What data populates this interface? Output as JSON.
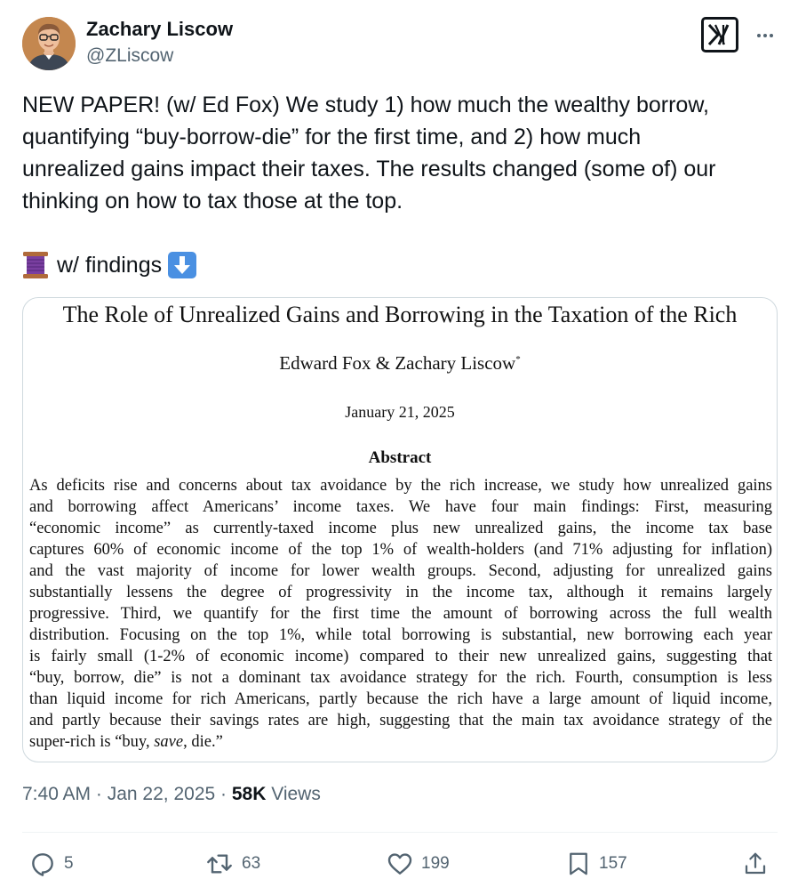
{
  "author": {
    "name": "Zachary Liscow",
    "handle": "@ZLiscow"
  },
  "tweet": {
    "lines": [
      "NEW PAPER! (w/ Ed Fox) We study 1) how much the wealthy borrow,",
      "quantifying “buy-borrow-die” for the first time, and 2) how much",
      "unrealized gains impact their taxes. The results changed (some of) our",
      "thinking on how to tax those at the top."
    ],
    "thread_text": "w/ findings"
  },
  "paper": {
    "title": "The Role of Unrealized Gains and Borrowing in the Taxation of the Rich",
    "authors": "Edward Fox & Zachary Liscow",
    "author_mark": "*",
    "date": "January 21, 2025",
    "abstract_heading": "Abstract",
    "abstract_lines": [
      "As deficits rise and concerns about tax avoidance by the rich increase, we study how unrealized gains",
      "and borrowing affect Americans’ income taxes. We have four main findings: First, measuring",
      "“economic income” as currently-taxed income plus new unrealized gains, the income tax base",
      "captures 60% of economic income of the top 1% of wealth-holders (and 71% adjusting for inflation)",
      "and the vast majority of income for lower wealth groups. Second, adjusting for unrealized gains",
      "substantially lessens the degree of progressivity in the income tax, although it remains largely",
      "progressive. Third, we quantify for the first time the amount of borrowing across the full wealth",
      "distribution. Focusing on the top 1%, while total borrowing is substantial, new borrowing each year",
      "is fairly small (1-2% of economic income) compared to their new unrealized gains, suggesting that",
      "“buy, borrow, die” is not a dominant tax avoidance strategy for the rich. Fourth, consumption is less",
      "than liquid income for rich Americans, partly because the rich have a large amount of liquid income,",
      "and partly because their savings rates are high, suggesting that the main tax avoidance strategy of the"
    ],
    "abstract_last_prefix": "super-rich is “buy, ",
    "abstract_last_italic": "save",
    "abstract_last_suffix": ", die.”"
  },
  "meta": {
    "time": "7:40 AM",
    "separator": " · ",
    "date": "Jan 22, 2025",
    "views_count": "58K",
    "views_label": " Views"
  },
  "actions": {
    "replies": "5",
    "reposts": "63",
    "likes": "199",
    "bookmarks": "157"
  },
  "colors": {
    "text": "#0f1419",
    "secondary": "#536471",
    "border": "#cfd9de"
  },
  "icons": [
    "x-logo-icon",
    "more-icon",
    "spool-of-thread-icon",
    "down-arrow-icon",
    "reply-icon",
    "repost-icon",
    "like-icon",
    "bookmark-icon",
    "share-icon"
  ]
}
